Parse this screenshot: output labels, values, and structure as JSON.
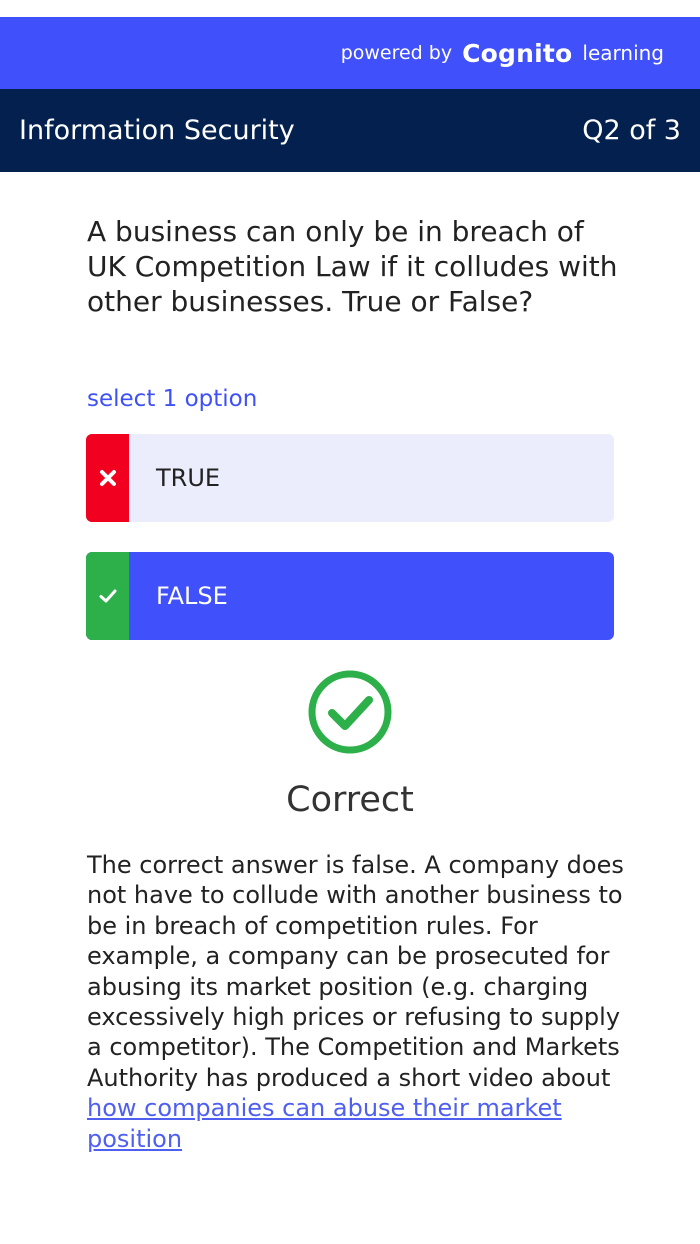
{
  "brand": {
    "powered_by": "powered by",
    "name": "Cognito",
    "suffix": "learning"
  },
  "header": {
    "course_title": "Information Security",
    "progress": "Q2 of 3"
  },
  "question": {
    "text": "A business can only be in breach of UK Competition Law if it colludes with other businesses. True or False?",
    "instruction": "select 1 option"
  },
  "options": [
    {
      "label": "TRUE",
      "state": "incorrect",
      "marker_icon": "cross-icon",
      "marker_color": "#f1001f"
    },
    {
      "label": "FALSE",
      "state": "correct-selected",
      "marker_icon": "check-icon",
      "marker_color": "#2db04a"
    }
  ],
  "result": {
    "icon": "check-circle-icon",
    "title": "Correct",
    "color": "#2db04a"
  },
  "explanation": {
    "text": "The correct answer is false. A company does not have to collude with another business to be in breach of competition rules. For example, a company can be prosecuted for abusing its market position (e.g. charging excessively high prices or refusing to supply a competitor). The Competition and Markets Authority has produced a short video about ",
    "link_text": "how companies can abuse their market position"
  },
  "colors": {
    "brand_bar": "#4050fa",
    "title_bar": "#03204f",
    "accent": "#3f51f5",
    "option_idle": "#ebedfc",
    "option_selected": "#4050fa",
    "wrong": "#f1001f",
    "right": "#2db04a"
  }
}
